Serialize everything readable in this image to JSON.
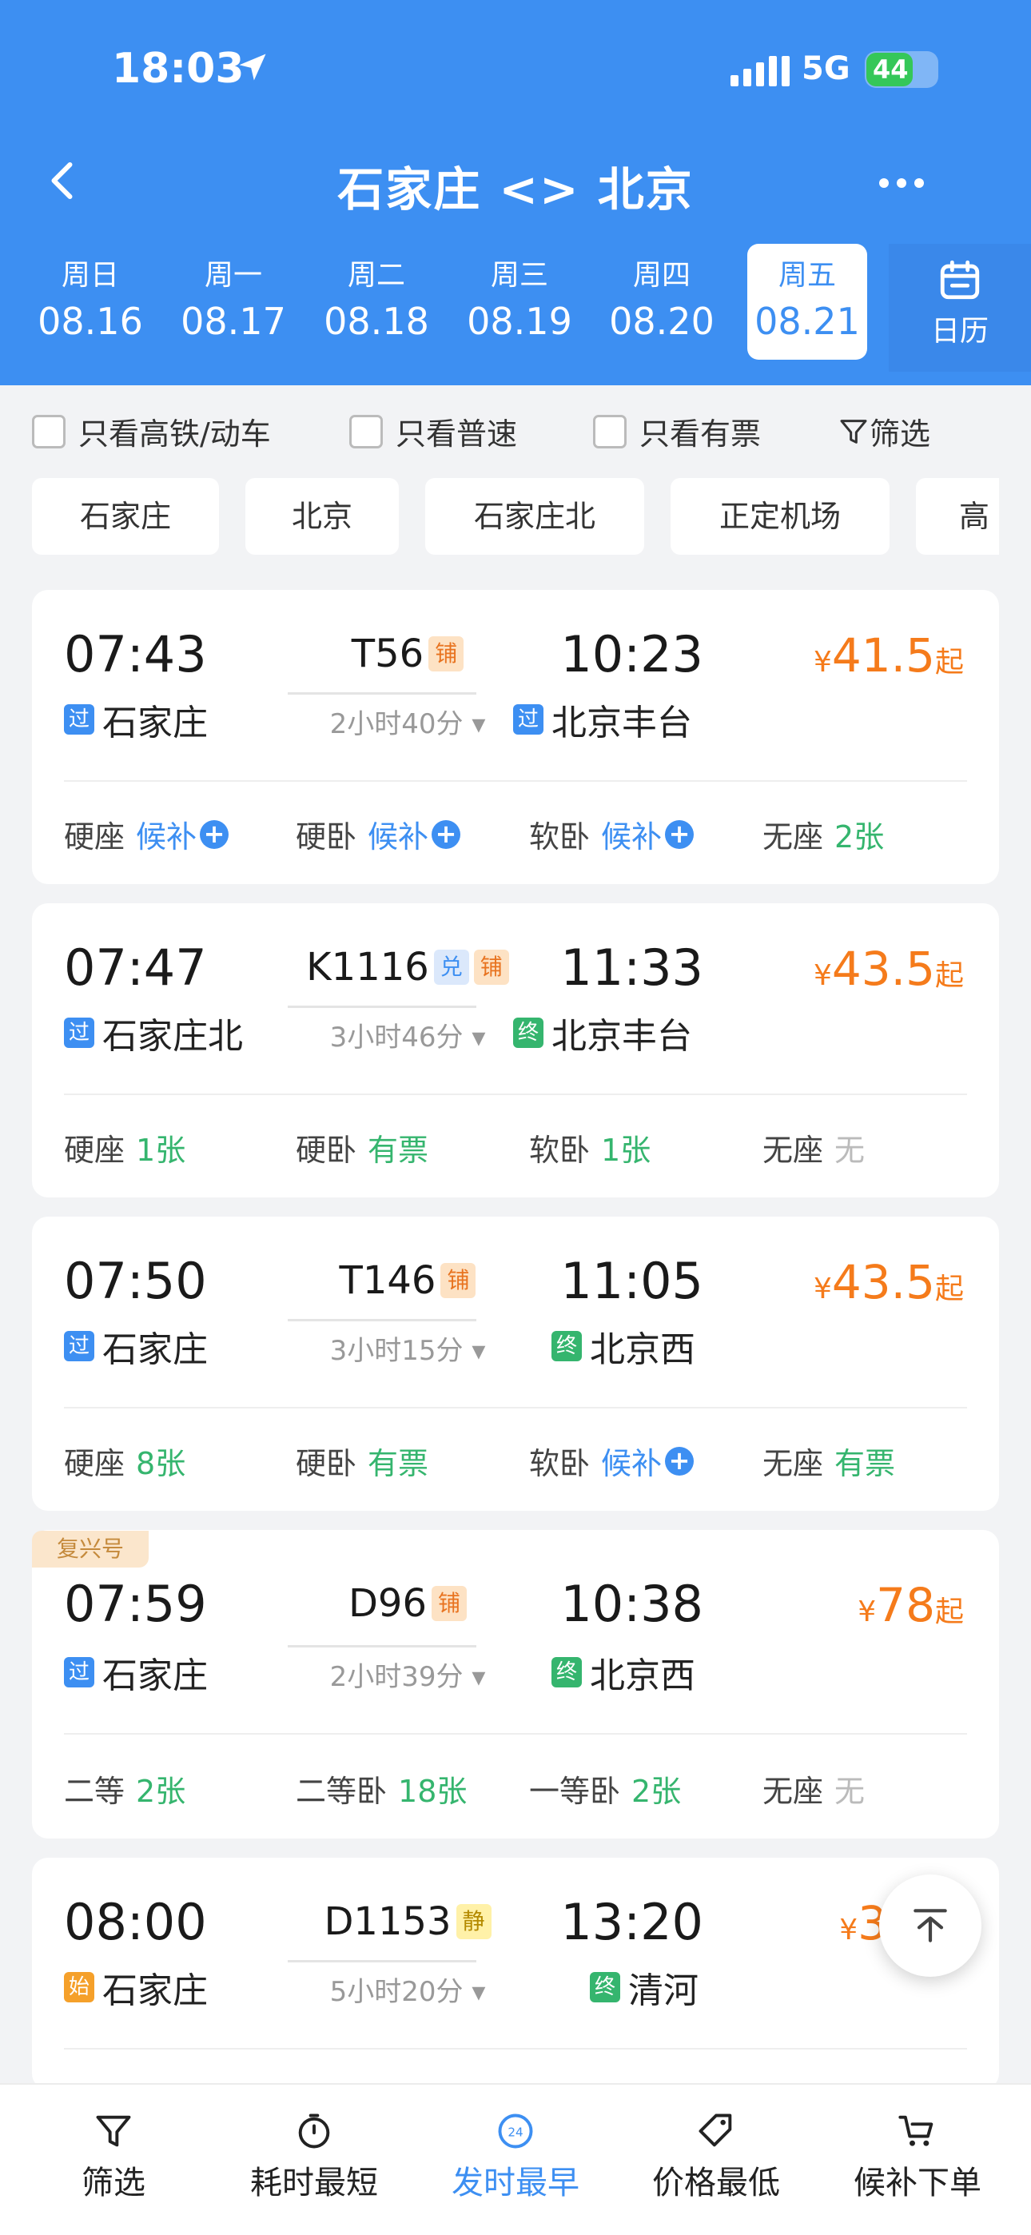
{
  "status_bar": {
    "time": "18:03",
    "network": "5G",
    "battery": "44"
  },
  "header": {
    "title": "石家庄 <> 北京"
  },
  "date_tabs": [
    {
      "weekday": "周日",
      "date": "08.16"
    },
    {
      "weekday": "周一",
      "date": "08.17"
    },
    {
      "weekday": "周二",
      "date": "08.18"
    },
    {
      "weekday": "周三",
      "date": "08.19"
    },
    {
      "weekday": "周四",
      "date": "08.20"
    },
    {
      "weekday": "周五",
      "date": "08.21",
      "active": true
    }
  ],
  "calendar_label": "日历",
  "filters": {
    "high_speed": "只看高铁/动车",
    "normal": "只看普速",
    "available": "只看有票",
    "filter": "筛选"
  },
  "stations": [
    "石家庄",
    "北京",
    "石家庄北",
    "正定机场",
    "高"
  ],
  "trains": [
    {
      "dep_time": "07:43",
      "arr_time": "10:23",
      "train_no": "T56",
      "badges": [
        "铺"
      ],
      "duration": "2小时40分",
      "dep_tag": "过",
      "dep_station": "石家庄",
      "arr_tag": "过",
      "arr_station": "北京丰台",
      "price_symbol": "¥",
      "price": "41.5",
      "price_suffix": "起",
      "seats": [
        {
          "name": "硬座",
          "value": "候补",
          "plus": true
        },
        {
          "name": "硬卧",
          "value": "候补",
          "plus": true
        },
        {
          "name": "软卧",
          "value": "候补",
          "plus": true
        },
        {
          "name": "无座",
          "value": "2张"
        }
      ]
    },
    {
      "dep_time": "07:47",
      "arr_time": "11:33",
      "train_no": "K1116",
      "badges": [
        "兑",
        "铺"
      ],
      "duration": "3小时46分",
      "dep_tag": "过",
      "dep_station": "石家庄北",
      "arr_tag": "终",
      "arr_station": "北京丰台",
      "price_symbol": "¥",
      "price": "43.5",
      "price_suffix": "起",
      "seats": [
        {
          "name": "硬座",
          "value": "1张"
        },
        {
          "name": "硬卧",
          "value": "有票"
        },
        {
          "name": "软卧",
          "value": "1张"
        },
        {
          "name": "无座",
          "value": "无"
        }
      ]
    },
    {
      "dep_time": "07:50",
      "arr_time": "11:05",
      "train_no": "T146",
      "badges": [
        "铺"
      ],
      "duration": "3小时15分",
      "dep_tag": "过",
      "dep_station": "石家庄",
      "arr_tag": "终",
      "arr_station": "北京西",
      "price_symbol": "¥",
      "price": "43.5",
      "price_suffix": "起",
      "seats": [
        {
          "name": "硬座",
          "value": "8张"
        },
        {
          "name": "硬卧",
          "value": "有票"
        },
        {
          "name": "软卧",
          "value": "候补",
          "plus": true
        },
        {
          "name": "无座",
          "value": "有票"
        }
      ]
    },
    {
      "label": "复兴号",
      "dep_time": "07:59",
      "arr_time": "10:38",
      "train_no": "D96",
      "badges": [
        "铺"
      ],
      "duration": "2小时39分",
      "dep_tag": "过",
      "dep_station": "石家庄",
      "arr_tag": "终",
      "arr_station": "北京西",
      "price_symbol": "¥",
      "price": "78",
      "price_suffix": "起",
      "seats": [
        {
          "name": "二等",
          "value": "2张"
        },
        {
          "name": "二等卧",
          "value": "18张"
        },
        {
          "name": "一等卧",
          "value": "2张"
        },
        {
          "name": "无座",
          "value": "无"
        }
      ]
    },
    {
      "dep_time": "08:00",
      "arr_time": "13:20",
      "train_no": "D1153",
      "badges": [
        "静"
      ],
      "duration": "5小时20分",
      "dep_tag": "始",
      "dep_station": "石家庄",
      "arr_tag": "终",
      "arr_station": "清河",
      "price_symbol": "¥",
      "price": "3",
      "price_suffix": ""
    }
  ],
  "bottom_bar": [
    "筛选",
    "耗时最短",
    "发时最早",
    "价格最低",
    "候补下单"
  ],
  "icons": {
    "back": "chevron-left-icon",
    "more": "more-dots-icon",
    "calendar": "calendar-icon",
    "filter": "funnel-icon",
    "timer": "timer-icon",
    "clock24": "clock-24-icon",
    "tag": "price-tag-icon",
    "cart": "cart-icon",
    "top": "arrow-up-top-icon"
  },
  "colors": {
    "primary": "#3d8ff2",
    "price": "#f57b1b",
    "available": "#35b56e",
    "none": "#bbbbbb"
  }
}
